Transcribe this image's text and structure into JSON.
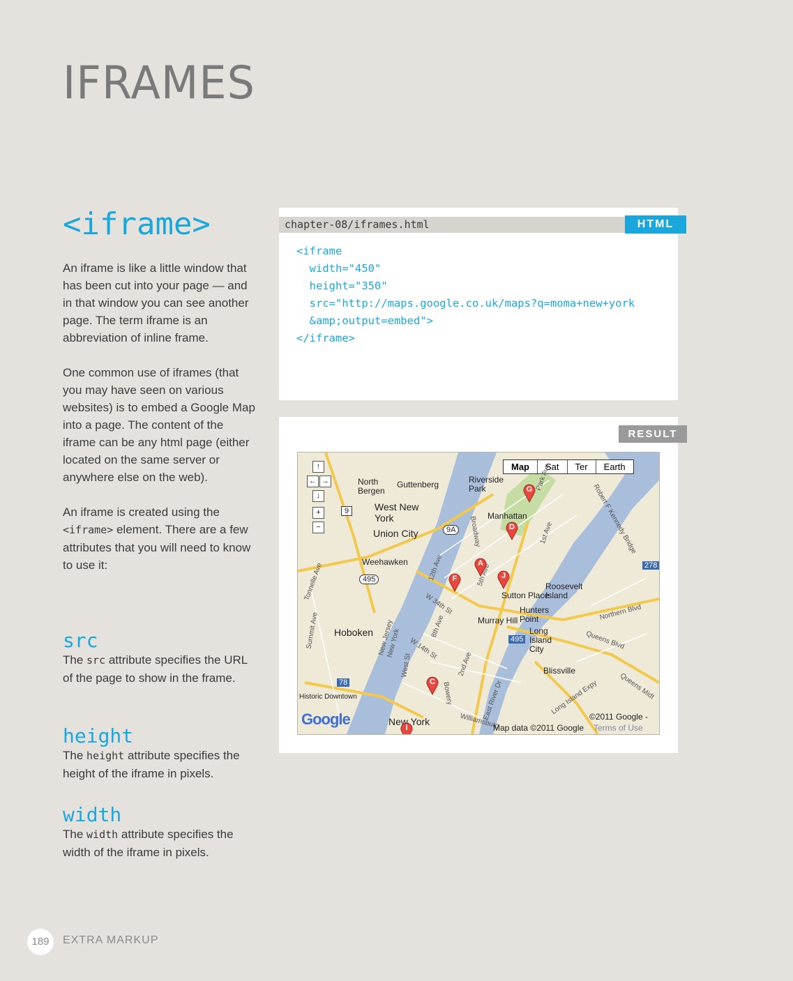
{
  "page": {
    "title": "IFRAMES",
    "page_number": "189",
    "section": "EXTRA MARKUP"
  },
  "element": {
    "heading": "<iframe>",
    "paragraph1": "An iframe is like a little window that has been cut into your page — and in that window you can see another page. The term iframe is an abbreviation of inline frame.",
    "paragraph2": "One common use of iframes (that you may have seen on various websites) is to embed a Google Map into a page. The content of the iframe can be any html page (either located on the same server or anywhere else on the web).",
    "paragraph3_before": "An iframe is created using the ",
    "paragraph3_code": "<iframe>",
    "paragraph3_after": " element. There are a few attributes that you will need to know to use it:"
  },
  "attributes": [
    {
      "name": "src",
      "desc_before": "The ",
      "code": "src",
      "desc_after": " attribute specifies the URL of the page to show in the frame."
    },
    {
      "name": "height",
      "desc_before": "The ",
      "code": "height",
      "desc_after": " attribute specifies the height of the iframe in pixels."
    },
    {
      "name": "width",
      "desc_before": "The ",
      "code": "width",
      "desc_after": " attribute specifies the width of the iframe in pixels."
    }
  ],
  "code_panel": {
    "filename": "chapter-08/iframes.html",
    "tag": "HTML",
    "lines": [
      "<iframe",
      "  width=\"450\"",
      "  height=\"350\"",
      "  src=\"http://maps.google.co.uk/maps?q=moma+new+york",
      "  &amp;output=embed\">",
      "</iframe>"
    ]
  },
  "result_panel": {
    "tag": "RESULT",
    "map": {
      "types": [
        "Map",
        "Sat",
        "Ter",
        "Earth"
      ],
      "active_type": "Map",
      "logo": "Google",
      "copyright": "©2011 Google -",
      "map_data": "Map data ©2011 Google",
      "terms": "Terms of Use",
      "places": [
        "North Bergen",
        "Guttenberg",
        "Riverside Park",
        "West New York",
        "Union City",
        "Manhattan",
        "Weehawken",
        "Hoboken",
        "Roosevelt Island",
        "Sutton Place",
        "Murray Hill",
        "Hunters Point",
        "Long Island City",
        "Blissville",
        "New York",
        "Historic Downtown"
      ],
      "roads": [
        "Broadway",
        "12th Ave",
        "5th Ave",
        "1st Ave",
        "W 34th St",
        "8th Ave",
        "W 14th St",
        "2nd Ave",
        "West St",
        "Bowery",
        "East River Dr",
        "Northern Blvd",
        "Queens Blvd",
        "Queens Midt",
        "Williamsburg",
        "Tonnelle Ave",
        "Summit Ave",
        "New Jersey",
        "New York",
        "Park Ave",
        "Robert F Kennedy Bridge",
        "Long Island Expy"
      ],
      "shields": [
        "9",
        "9A",
        "495",
        "278",
        "78",
        "495"
      ],
      "markers": [
        "G",
        "D",
        "A",
        "F",
        "J",
        "C",
        "I"
      ],
      "nav": [
        "↑",
        "←",
        "→",
        "↓",
        "+",
        "−"
      ]
    }
  }
}
